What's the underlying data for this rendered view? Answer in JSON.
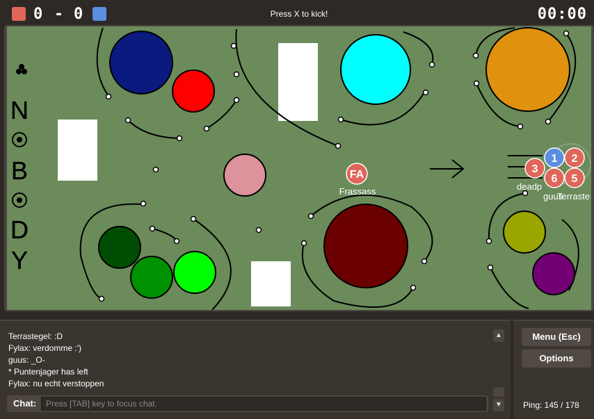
{
  "header": {
    "score_red": "0",
    "score_separator": "-",
    "score_blue": "0",
    "kick_hint": "Press X to kick!",
    "timer": "00:00",
    "team_colors": {
      "red": "#e0665a",
      "blue": "#5b8de0"
    }
  },
  "field": {
    "background": "#6b8b5a",
    "vertical_text": [
      "N",
      "B",
      "D",
      "Y"
    ],
    "players": [
      {
        "label": "FA",
        "name": "Frassass",
        "team": "red"
      },
      {
        "label": "1",
        "name": "",
        "team": "blue"
      },
      {
        "label": "2",
        "name": "",
        "team": "red"
      },
      {
        "label": "3",
        "name": "deadp",
        "team": "red"
      },
      {
        "label": "6",
        "name": "guus",
        "team": "red"
      },
      {
        "label": "5",
        "name": "Terraste",
        "team": "red"
      }
    ]
  },
  "chat": {
    "messages": [
      "Terrastegel: :D",
      "Fylax: verdomme :')",
      "guus: _O-",
      "* Puntenjager has left",
      "Fylax: nu echt verstoppen"
    ],
    "label": "Chat:",
    "placeholder": "Press [TAB] key to focus chat.",
    "scroll_up": "▲",
    "scroll_down": "▼"
  },
  "side": {
    "menu_label": "Menu (Esc)",
    "options_label": "Options",
    "ping": "Ping: 145 / 178"
  }
}
